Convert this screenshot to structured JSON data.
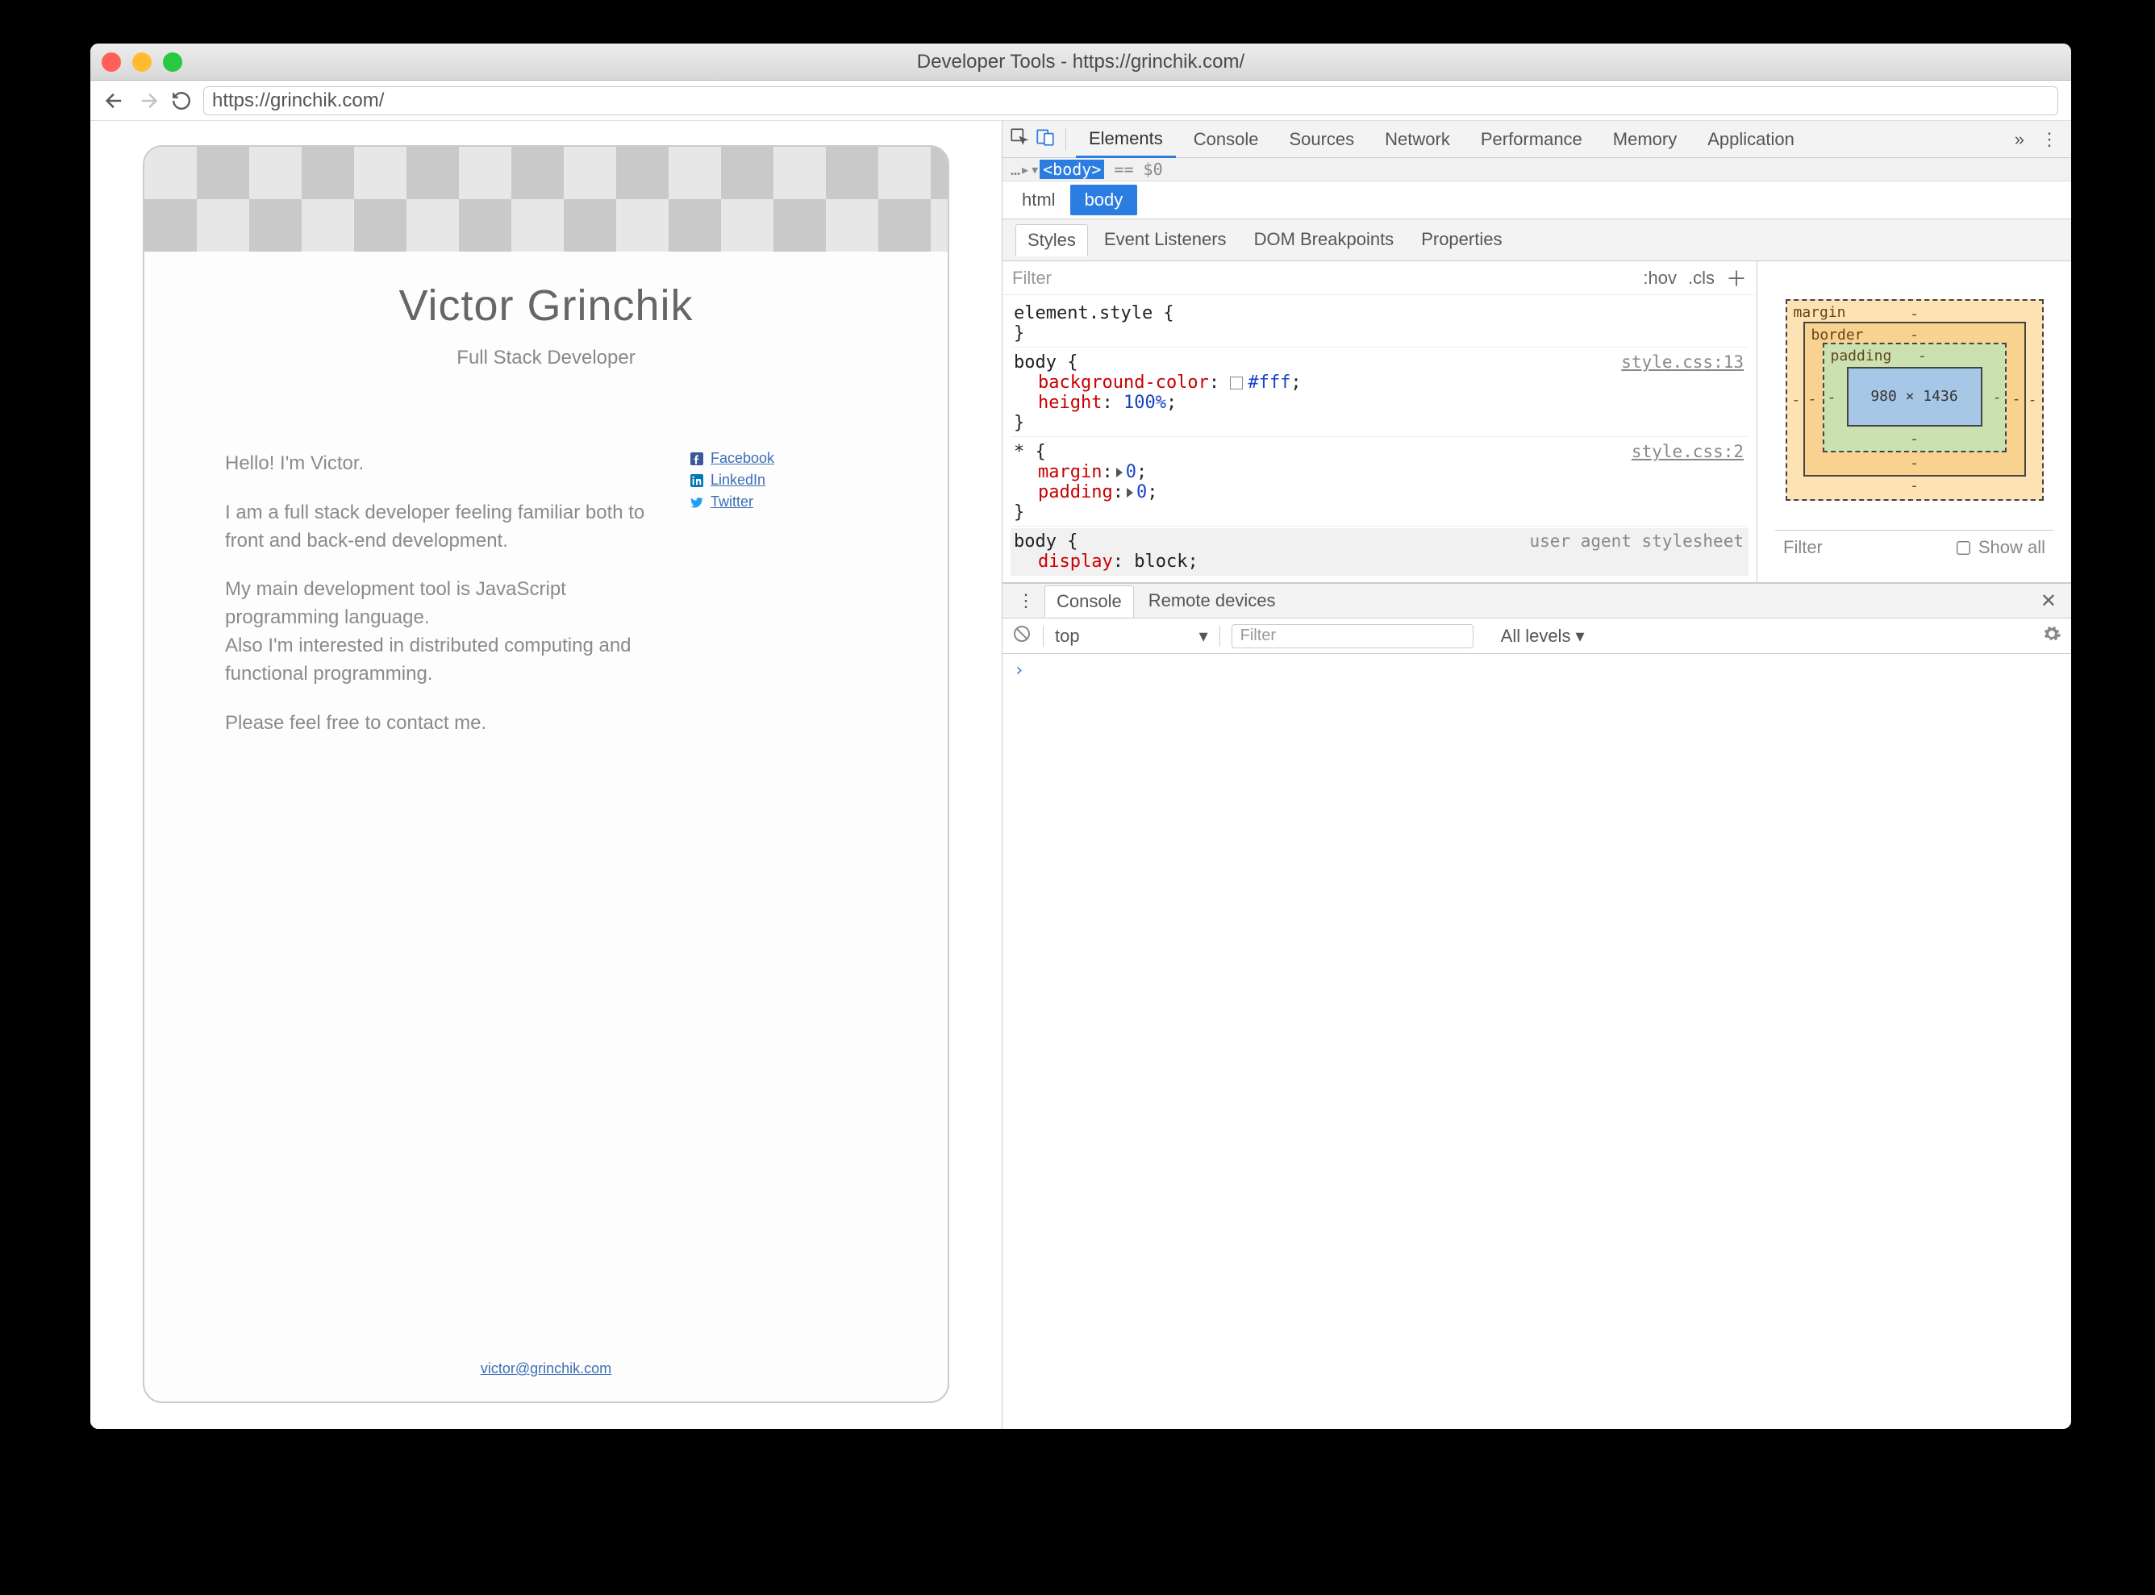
{
  "window": {
    "title": "Developer Tools - https://grinchik.com/"
  },
  "urlbar": {
    "value": "https://grinchik.com/"
  },
  "page": {
    "name": "Victor Grinchik",
    "role": "Full Stack Developer",
    "bio1": "Hello! I'm Victor.",
    "bio2": "I am a full stack developer feeling familiar both to front and back-end development.",
    "bio3": "My main development tool is JavaScript programming language.",
    "bio4": "Also I'm interested in distributed computing and functional programming.",
    "bio5": "Please feel free to contact me.",
    "links": {
      "fb": "Facebook",
      "li": "LinkedIn",
      "tw": "Twitter"
    },
    "email": "victor@grinchik.com"
  },
  "devtools": {
    "tabs": [
      "Elements",
      "Console",
      "Sources",
      "Network",
      "Performance",
      "Memory",
      "Application"
    ],
    "active_tab": "Elements",
    "dom_line_prefix": "…▸▾",
    "dom_line_tag": "<body>",
    "dom_line_suffix": " == $0",
    "crumbs": [
      "html",
      "body"
    ],
    "active_crumb": "body",
    "subtabs": [
      "Styles",
      "Event Listeners",
      "DOM Breakpoints",
      "Properties"
    ],
    "active_subtab": "Styles",
    "filter_label": "Filter",
    "hov": ":hov",
    "cls": ".cls",
    "rules": {
      "r1_sel": "element.style {",
      "r1_close": "}",
      "r2_sel": "body {",
      "r2_src": "style.css:13",
      "r2_p1k": "background-color",
      "r2_p1v": "#fff",
      "r2_p2k": "height",
      "r2_p2v": "100%",
      "r2_close": "}",
      "r3_sel": "* {",
      "r3_src": "style.css:2",
      "r3_p1k": "margin",
      "r3_p1v": "0",
      "r3_p2k": "padding",
      "r3_p2v": "0",
      "r3_close": "}",
      "r4_sel": "body {",
      "r4_src": "user agent stylesheet",
      "r4_p1k": "display",
      "r4_p1v": "block"
    },
    "boxmodel": {
      "margin": "margin",
      "border": "border",
      "padding": "padding",
      "dims": "980 × 1436",
      "dash": "-"
    },
    "computed_filter": "Filter",
    "show_all": "Show all",
    "drawer": {
      "tabs": [
        "Console",
        "Remote devices"
      ],
      "active": "Console",
      "context": "top",
      "filter_ph": "Filter",
      "levels": "All levels",
      "prompt": "›"
    }
  }
}
